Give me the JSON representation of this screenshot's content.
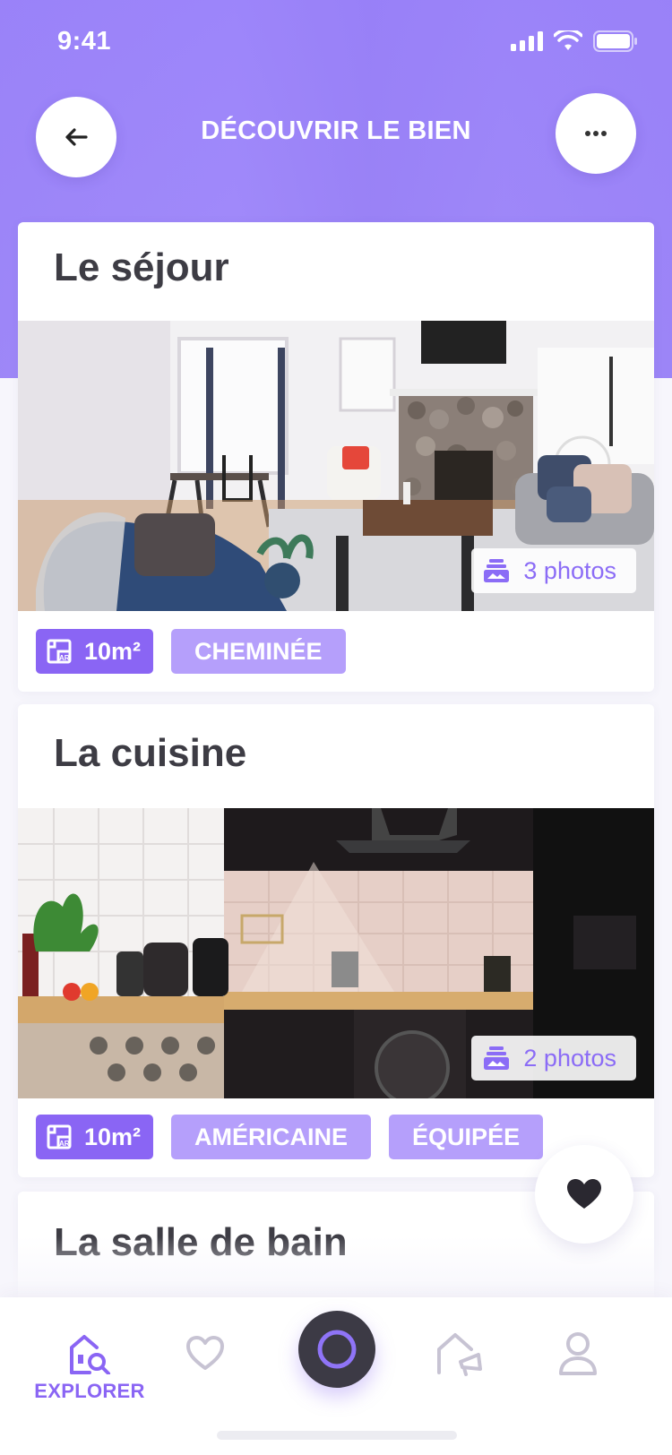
{
  "status_bar": {
    "time": "9:41"
  },
  "header": {
    "title": "DÉCOUVRIR LE BIEN"
  },
  "rooms": [
    {
      "title": "Le séjour",
      "photos_label": "3 photos",
      "area": "10m²",
      "tags": [
        "CHEMINÉE"
      ]
    },
    {
      "title": "La cuisine",
      "photos_label": "2 photos",
      "area": "10m²",
      "tags": [
        "AMÉRICAINE",
        "ÉQUIPÉE"
      ]
    },
    {
      "title": "La salle de bain"
    }
  ],
  "tabbar": {
    "explorer_label": "EXPLORER"
  },
  "colors": {
    "accent": "#8a65f4",
    "accent_light": "#b59ffb",
    "hero": "#967dfa",
    "text": "#3d3c44"
  },
  "icons": {
    "back": "arrow-left-icon",
    "more": "more-dots-icon",
    "photos": "gallery-stack-icon",
    "area": "floor-plan-icon",
    "favorite": "heart-filled-icon",
    "explorer": "house-search-icon",
    "favorites_tab": "heart-outline-icon",
    "center": "ring-icon",
    "offers": "house-megaphone-icon",
    "profile": "user-icon"
  }
}
